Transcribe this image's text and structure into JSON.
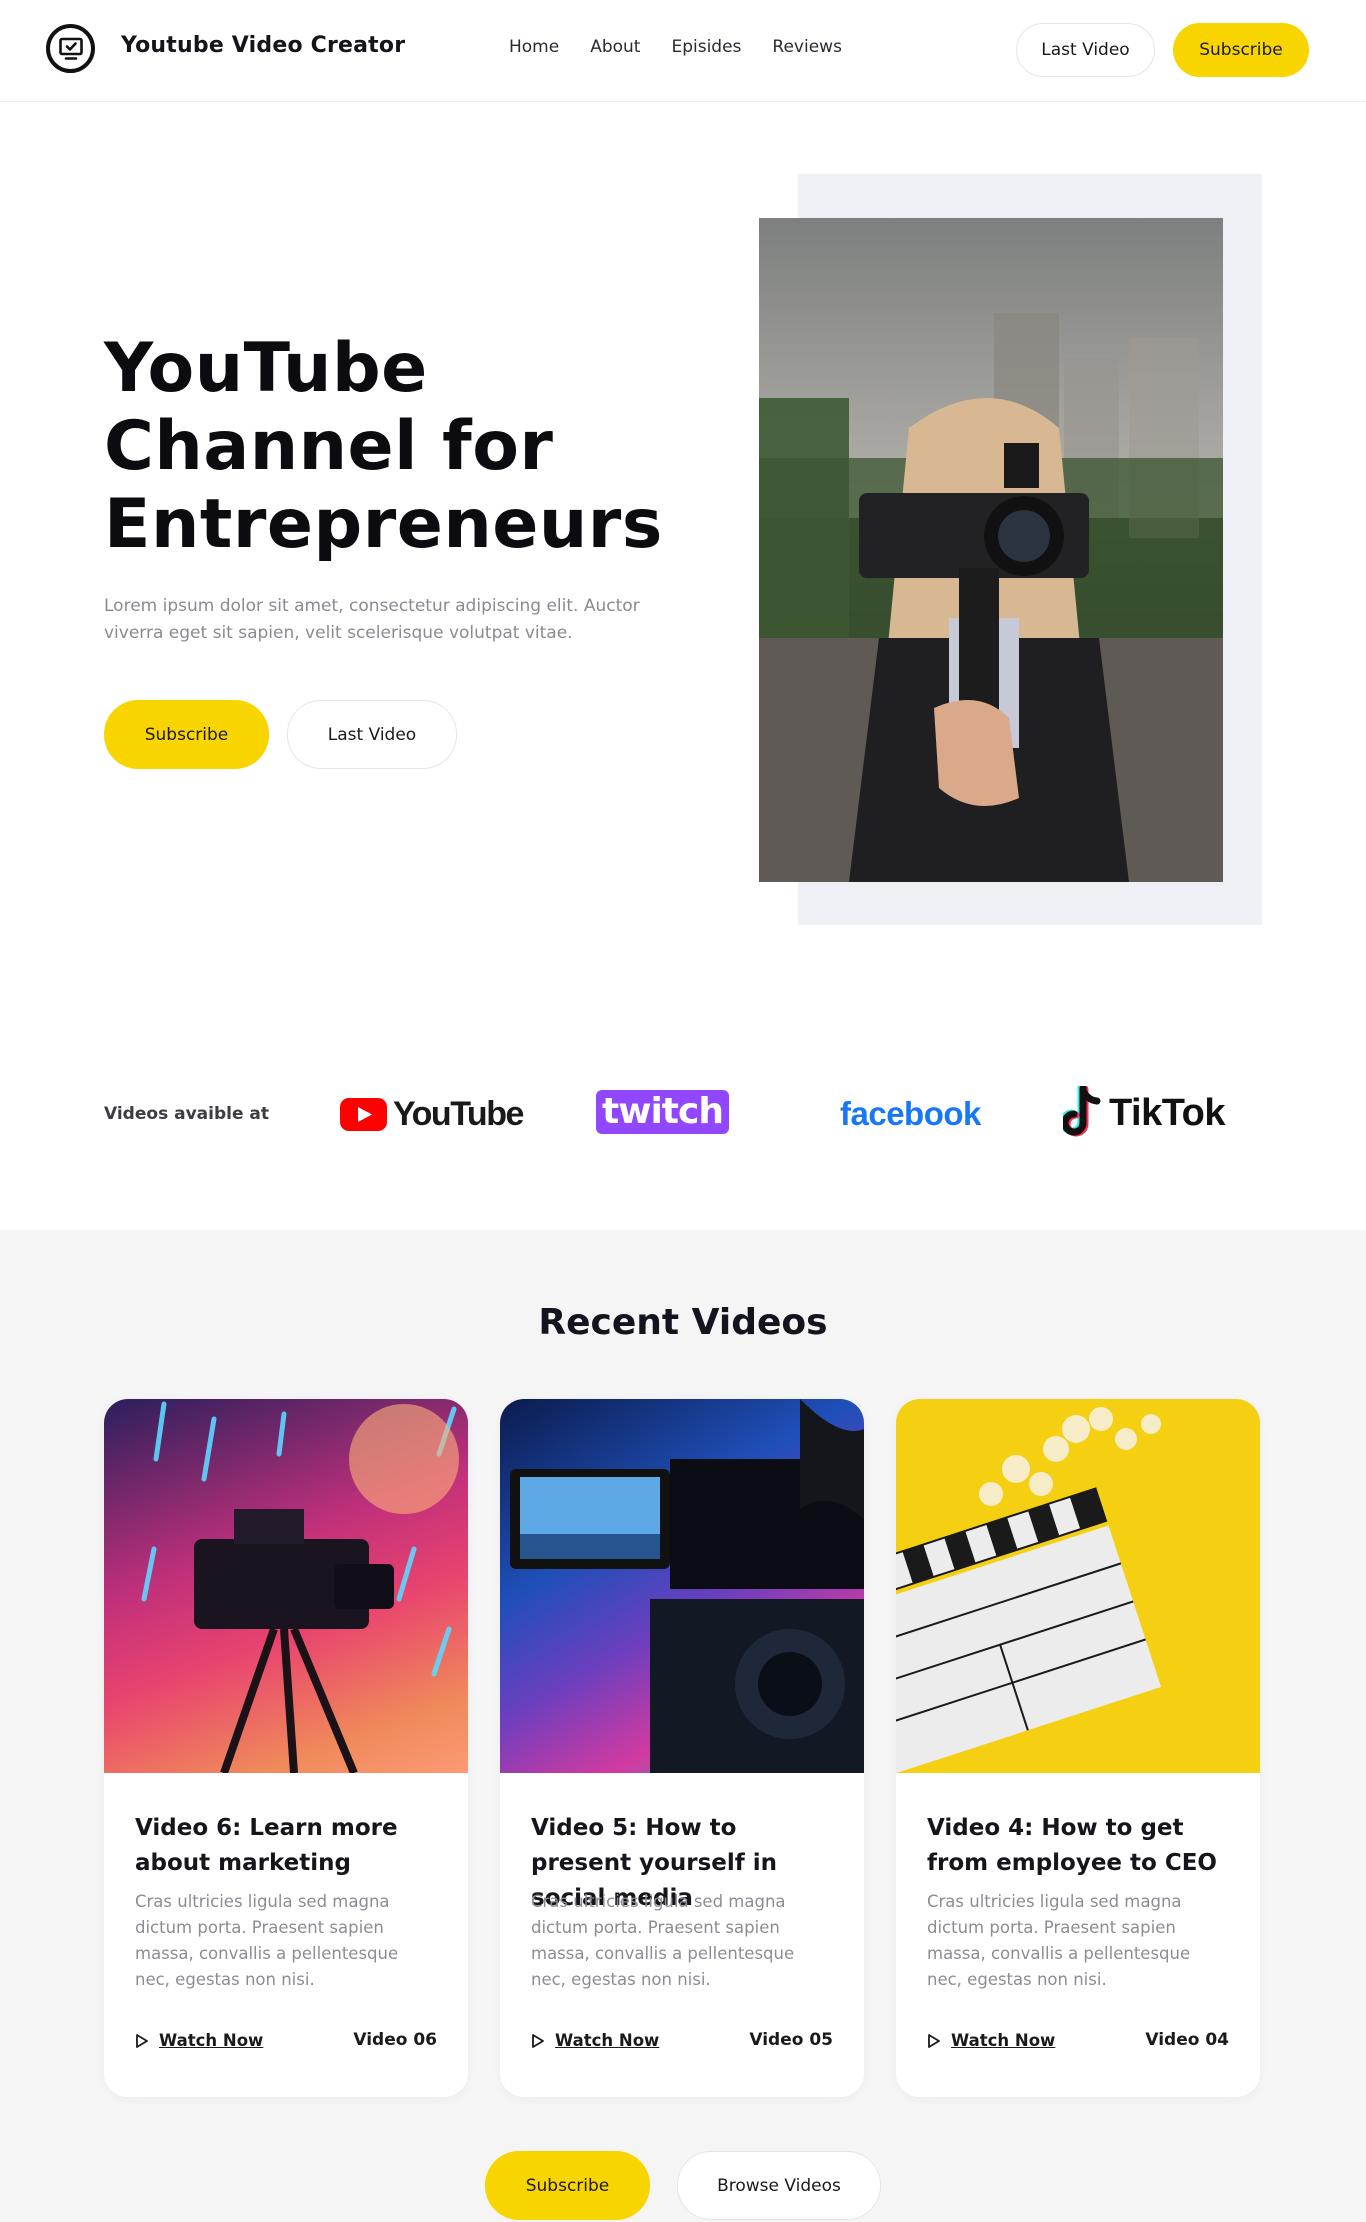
{
  "header": {
    "brand": "Youtube Video Creator",
    "nav": [
      "Home",
      "About",
      "Episides",
      "Reviews"
    ],
    "last_video": "Last Video",
    "subscribe": "Subscribe"
  },
  "hero": {
    "title_lines": [
      "YouTube",
      "Channel for",
      "Entrepreneurs"
    ],
    "description": "Lorem ipsum dolor sit amet, consectetur adipiscing elit. Auctor viverra eget sit sapien, velit scelerisque volutpat vitae.",
    "subscribe": "Subscribe",
    "last_video": "Last Video"
  },
  "platforms": {
    "label": "Videos avaible at",
    "logos": [
      "YouTube",
      "twitch",
      "facebook",
      "TikTok"
    ]
  },
  "recent": {
    "title": "Recent Videos",
    "cards": [
      {
        "title": "Video 6: Learn more about marketing",
        "description": "Cras ultricies ligula sed magna dictum porta. Praesent sapien massa, convallis a pellentesque nec, egestas non nisi.",
        "watch": "Watch Now",
        "number": "Video 06"
      },
      {
        "title": "Video 5: How to present yourself in social media",
        "description": "Cras ultricies ligula sed magna dictum porta. Praesent sapien massa, convallis a pellentesque nec, egestas non nisi.",
        "watch": "Watch Now",
        "number": "Video 05"
      },
      {
        "title": "Video 4: How to get from employee to CEO",
        "description": "Cras ultricies ligula sed magna dictum porta. Praesent sapien massa, convallis a pellentesque nec, egestas non nisi.",
        "watch": "Watch Now",
        "number": "Video 04"
      }
    ],
    "subscribe": "Subscribe",
    "browse": "Browse Videos"
  },
  "colors": {
    "accent": "#f9d500",
    "youtube_red": "#ff0000",
    "twitch_purple": "#9146ff",
    "facebook_blue": "#1877f2"
  },
  "icons": [
    "monitor-check-icon",
    "play-outline-icon"
  ]
}
